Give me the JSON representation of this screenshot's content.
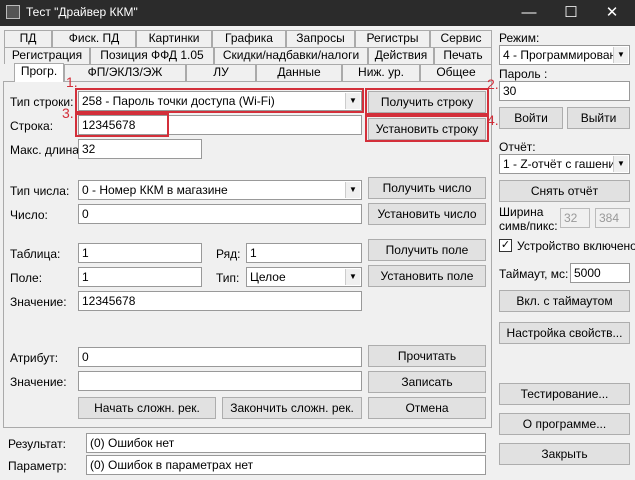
{
  "window": {
    "title": "Тест \"Драйвер ККМ\"",
    "minimize": "—",
    "maximize": "☐",
    "close": "✕"
  },
  "tabs_row1": [
    "ПД",
    "Фиск. ПД",
    "Картинки",
    "Графика",
    "Запросы",
    "Регистры",
    "Сервис"
  ],
  "tabs_row2": [
    "Регистрация",
    "Позиция ФФД 1.05",
    "Скидки/надбавки/налоги",
    "Действия",
    "Печать"
  ],
  "tabs_row3": [
    "Прогр.",
    "ФП/ЭКЛЗ/ЭЖ",
    "ЛУ",
    "Данные",
    "Ниж. ур.",
    "Общее"
  ],
  "form": {
    "string_type_label": "Тип строки:",
    "string_type_value": "258 - Пароль точки доступа (Wi-Fi)",
    "string_label": "Строка:",
    "string_value": "12345678",
    "maxlen_label": "Макс. длина:",
    "maxlen_value": "32",
    "get_string": "Получить строку",
    "set_string": "Установить строку",
    "number_type_label": "Тип числа:",
    "number_type_value": "0 - Номер ККМ в магазине",
    "number_label": "Число:",
    "number_value": "0",
    "get_number": "Получить число",
    "set_number": "Установить число",
    "table_label": "Таблица:",
    "table_value": "1",
    "row_label": "Ряд:",
    "row_value": "1",
    "field_label": "Поле:",
    "field_value": "1",
    "type_label": "Тип:",
    "type_value": "Целое",
    "value_label": "Значение:",
    "value_value": "12345678",
    "get_field": "Получить поле",
    "set_field": "Установить поле",
    "attr_label": "Атрибут:",
    "attr_value": "0",
    "value2_label": "Значение:",
    "value2_value": "",
    "read_btn": "Прочитать",
    "write_btn": "Записать",
    "cancel_btn": "Отмена",
    "start_rec_btn": "Начать сложн. рек.",
    "end_rec_btn": "Закончить сложн. рек."
  },
  "annotations": [
    "1.",
    "2.",
    "3.",
    "4."
  ],
  "bottom": {
    "result_label": "Результат:",
    "result_value": "(0) Ошибок нет",
    "param_label": "Параметр:",
    "param_value": "(0) Ошибок в параметрах нет"
  },
  "side": {
    "mode_label": "Режим:",
    "mode_value": "4 - Программировани",
    "password_label": "Пароль :",
    "password_value": "30",
    "login_btn": "Войти",
    "logout_btn": "Выйти",
    "report_label": "Отчёт:",
    "report_value": "1 - Z-отчёт с гашение",
    "take_report_btn": "Снять отчёт",
    "width_label_1": "Ширина",
    "width_label_2": "симв/пикс:",
    "width_sym": "32",
    "width_px": "384",
    "device_enabled_label": "Устройство включено",
    "device_enabled_mark": "✓",
    "timeout_label": "Таймаут, мс:",
    "timeout_value": "5000",
    "timeout_btn": "Вкл. с таймаутом",
    "props_btn": "Настройка свойств...",
    "testing_btn": "Тестирование...",
    "about_btn": "О программе...",
    "close_btn": "Закрыть"
  }
}
